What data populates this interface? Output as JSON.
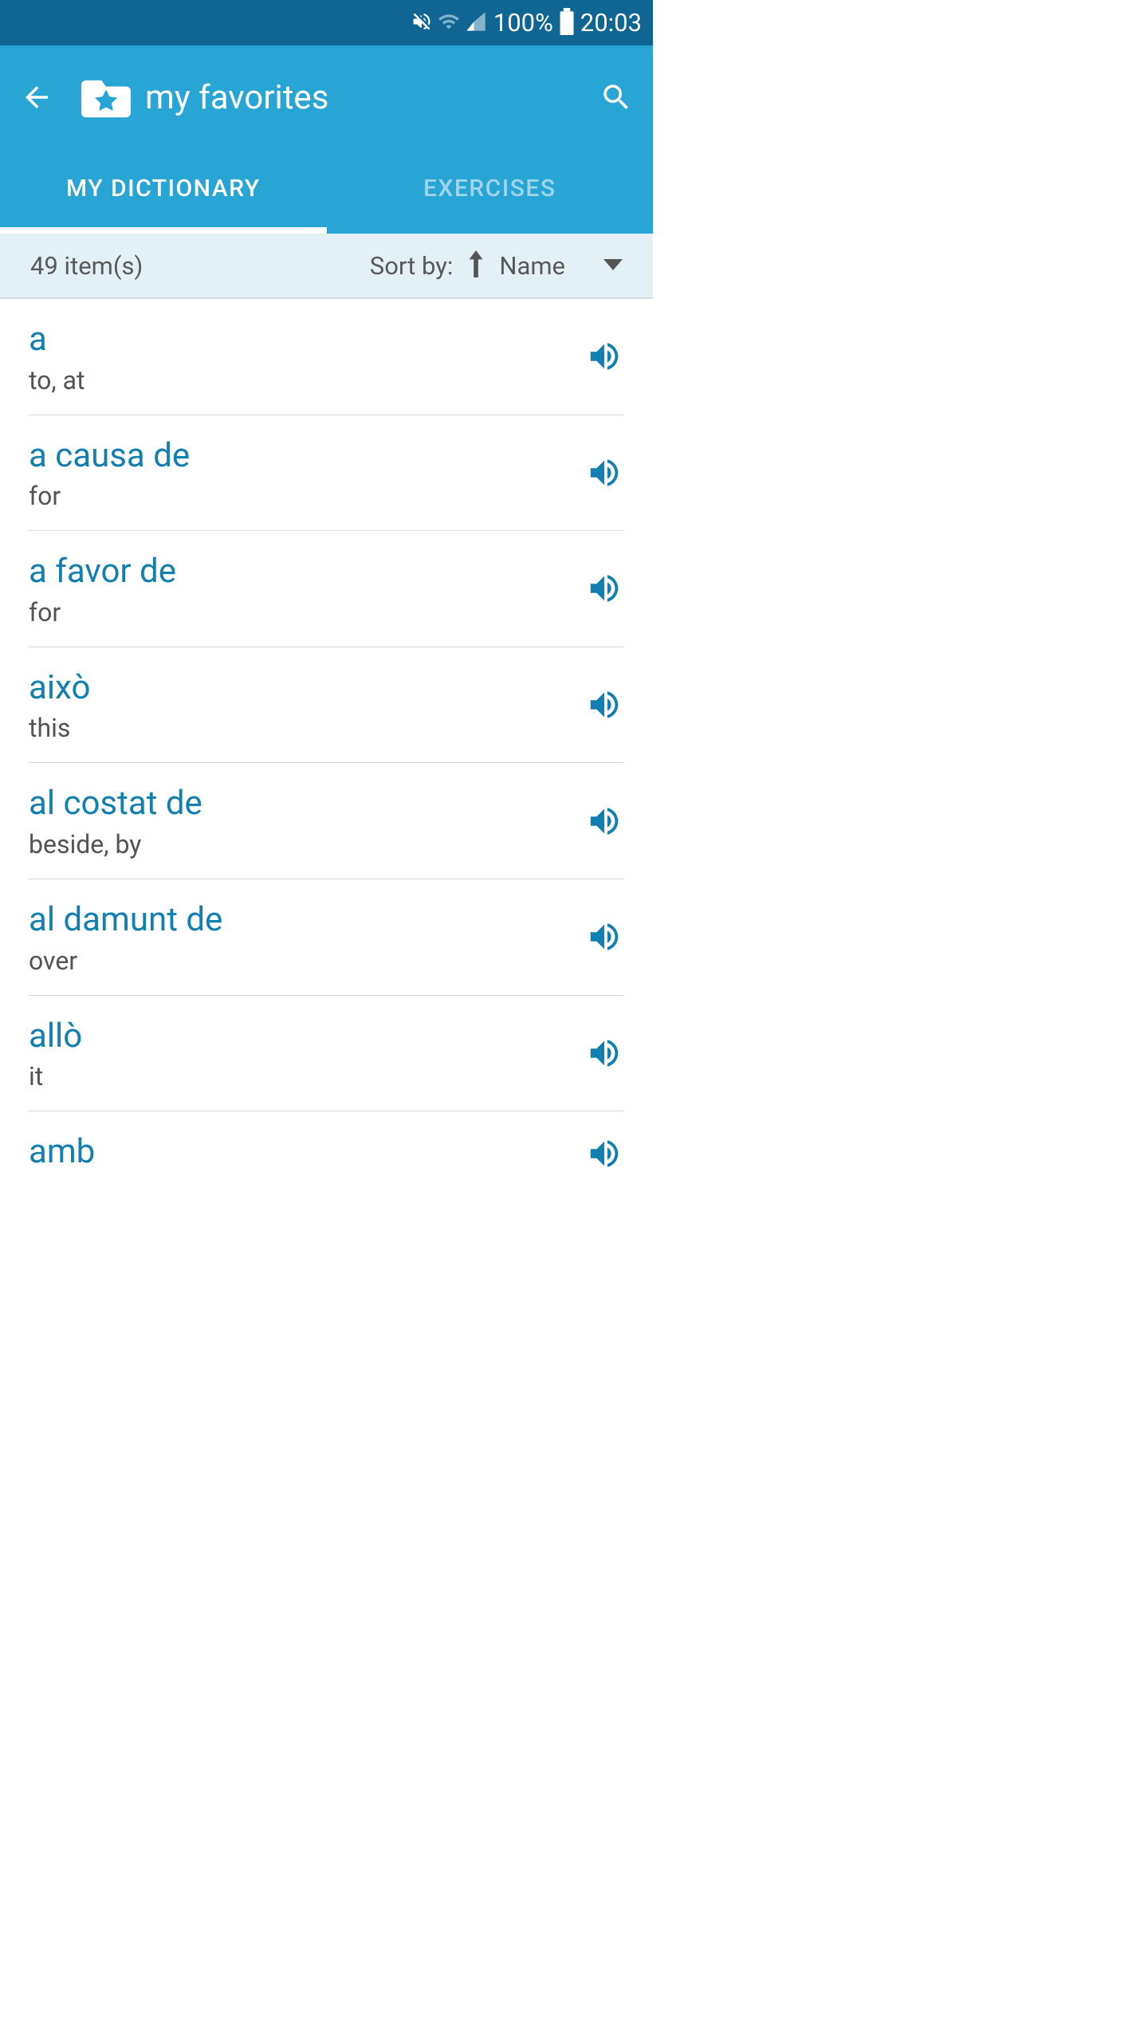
{
  "statusBar": {
    "battery": "100%",
    "time": "20:03"
  },
  "header": {
    "title": "my favorites"
  },
  "tabs": [
    {
      "label": "MY DICTIONARY",
      "active": true
    },
    {
      "label": "EXERCISES",
      "active": false
    }
  ],
  "sortBar": {
    "itemCount": "49 item(s)",
    "sortByLabel": "Sort by:",
    "sortValue": "Name"
  },
  "items": [
    {
      "word": "a",
      "translation": "to, at"
    },
    {
      "word": "a causa de",
      "translation": "for"
    },
    {
      "word": "a favor de",
      "translation": "for"
    },
    {
      "word": "això",
      "translation": "this"
    },
    {
      "word": "al costat de",
      "translation": "beside, by"
    },
    {
      "word": "al damunt de",
      "translation": "over"
    },
    {
      "word": "allò",
      "translation": "it"
    },
    {
      "word": "amb",
      "translation": ""
    }
  ]
}
